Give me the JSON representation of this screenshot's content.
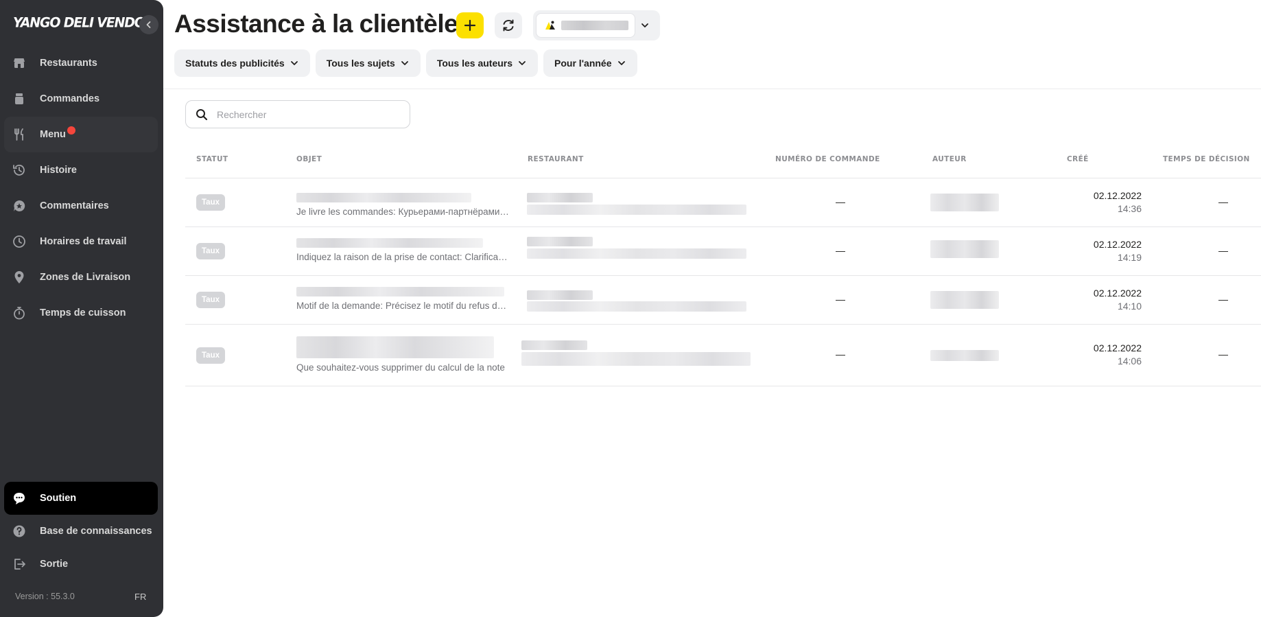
{
  "app": {
    "logo": "YANGO DELI VENDOR"
  },
  "sidebar": {
    "items": [
      {
        "label": "Restaurants",
        "icon": "store-icon"
      },
      {
        "label": "Commandes",
        "icon": "orders-icon"
      },
      {
        "label": "Menu",
        "icon": "fork-knife-icon",
        "badge": true
      },
      {
        "label": "Histoire",
        "icon": "history-icon"
      },
      {
        "label": "Commentaires",
        "icon": "star-comment-icon"
      },
      {
        "label": "Horaires de travail",
        "icon": "clock-icon"
      },
      {
        "label": "Zones de Livraison",
        "icon": "location-pin-icon"
      },
      {
        "label": "Temps de cuisson",
        "icon": "stopwatch-icon"
      }
    ],
    "bottom_items": [
      {
        "label": "Soutien",
        "icon": "chat-icon",
        "active": true
      },
      {
        "label": "Base de connaissances",
        "icon": "help-icon"
      },
      {
        "label": "Sortie",
        "icon": "logout-icon"
      }
    ],
    "version": "Version : 55.3.0",
    "language": "FR"
  },
  "header": {
    "title": "Assistance à la clientèle",
    "filters": [
      "Statuts des publicités",
      "Tous les sujets",
      "Tous les auteurs",
      "Pour l'année"
    ]
  },
  "search": {
    "placeholder": "Rechercher"
  },
  "table": {
    "columns": [
      "STATUT",
      "OBJET",
      "RESTAURANT",
      "NUMÉRO DE COMMANDE",
      "AUTEUR",
      "CRÉÉ",
      "TEMPS DE DÉCISION"
    ],
    "rows": [
      {
        "status": "Taux",
        "subject": "Je livre les commandes: Курьерами-партнёрами Яндекс.Еды",
        "order_number": "—",
        "created_date": "02.12.2022",
        "created_time": "14:36",
        "decision_time": "—"
      },
      {
        "status": "Taux",
        "subject": "Indiquez la raison de la prise de contact: Clarification",
        "order_number": "—",
        "created_date": "02.12.2022",
        "created_time": "14:19",
        "decision_time": "—"
      },
      {
        "status": "Taux",
        "subject": "Motif de la demande: Précisez le motif du refus de la commande",
        "order_number": "—",
        "created_date": "02.12.2022",
        "created_time": "14:10",
        "decision_time": "—"
      },
      {
        "status": "Taux",
        "subject": "Que souhaitez-vous supprimer du calcul de la note",
        "order_number": "—",
        "created_date": "02.12.2022",
        "created_time": "14:06",
        "decision_time": "—"
      }
    ]
  },
  "colors": {
    "accent": "#fce000",
    "sidebar_bg": "#2f3034",
    "badge_red": "#f5463c"
  }
}
